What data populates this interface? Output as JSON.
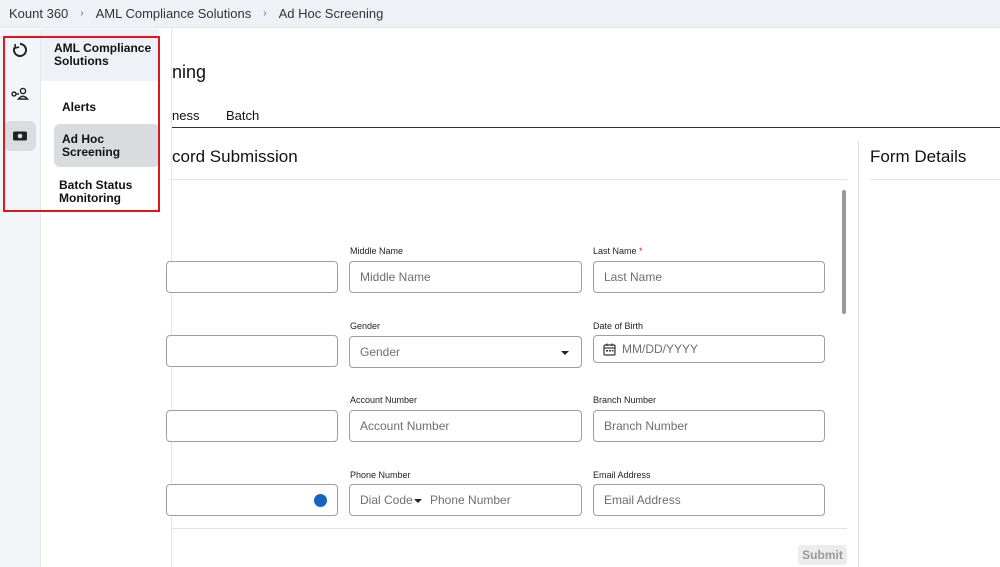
{
  "breadcrumb": [
    "Kount 360",
    "AML Compliance Solutions",
    "Ad Hoc Screening"
  ],
  "breadcrumb_separator": "›",
  "rail": {
    "icons": [
      "refresh-circle-icon",
      "person-link-icon",
      "money-screening-icon"
    ],
    "active_index": 2
  },
  "nav": {
    "header": "AML Compliance Solutions",
    "items": [
      {
        "label": "Alerts"
      },
      {
        "label": "Ad Hoc Screening"
      },
      {
        "label": "Batch Status Monitoring"
      }
    ],
    "active_index": 1,
    "highlight_color": "#e0161c"
  },
  "main": {
    "page_title_visible": "ning",
    "tabs": [
      {
        "label": "ness"
      },
      {
        "label": "Batch"
      }
    ],
    "section_title_visible": "cord Submission",
    "side_title": "Form Details",
    "submit_label": "Submit"
  },
  "form": {
    "middle_name": {
      "label": "Middle Name",
      "placeholder": "Middle Name"
    },
    "last_name": {
      "label": "Last Name",
      "required_mark": "*",
      "placeholder": "Last Name"
    },
    "gender": {
      "label": "Gender",
      "value": "Gender"
    },
    "dob": {
      "label": "Date of Birth",
      "placeholder": "MM/DD/YYYY"
    },
    "account_number": {
      "label": "Account Number",
      "placeholder": "Account Number"
    },
    "branch_number": {
      "label": "Branch Number",
      "placeholder": "Branch Number"
    },
    "phone_number": {
      "label": "Phone Number",
      "dial_code": "Dial Code",
      "placeholder": "Phone Number"
    },
    "email": {
      "label": "Email Address",
      "placeholder": "Email Address"
    }
  },
  "colors": {
    "accent": "#1764c0",
    "required": "#c0262d"
  }
}
